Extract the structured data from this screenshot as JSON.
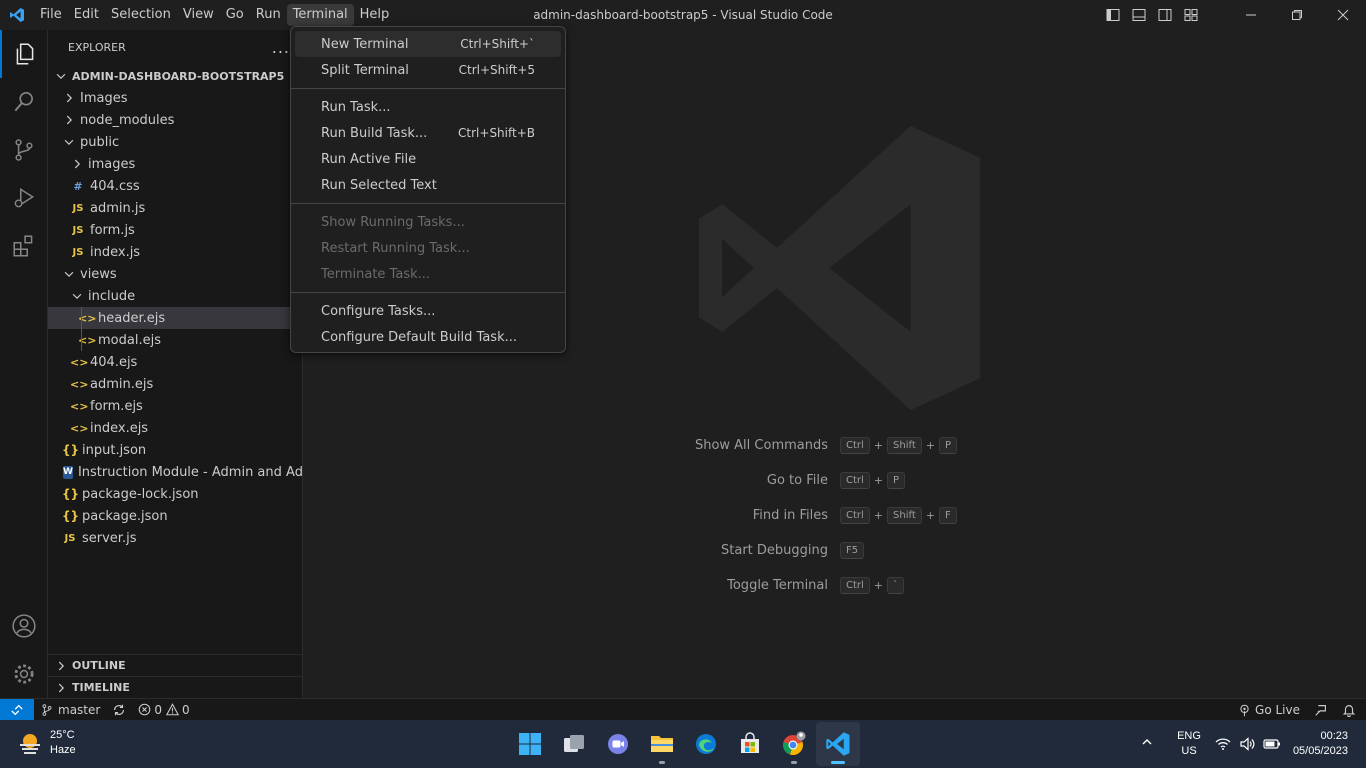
{
  "window": {
    "title": "admin-dashboard-bootstrap5 - Visual Studio Code"
  },
  "menubar": [
    "File",
    "Edit",
    "Selection",
    "View",
    "Go",
    "Run",
    "Terminal",
    "Help"
  ],
  "explorer": {
    "header": "EXPLORER",
    "more": "...",
    "root": "ADMIN-DASHBOARD-BOOTSTRAP5",
    "tree": [
      {
        "label": "Images",
        "type": "folder",
        "depth": 0,
        "open": false
      },
      {
        "label": "node_modules",
        "type": "folder",
        "depth": 0,
        "open": false
      },
      {
        "label": "public",
        "type": "folder",
        "depth": 0,
        "open": true
      },
      {
        "label": "images",
        "type": "folder",
        "depth": 1,
        "open": false
      },
      {
        "label": "404.css",
        "type": "css",
        "depth": 1
      },
      {
        "label": "admin.js",
        "type": "js",
        "depth": 1
      },
      {
        "label": "form.js",
        "type": "js",
        "depth": 1
      },
      {
        "label": "index.js",
        "type": "js",
        "depth": 1
      },
      {
        "label": "views",
        "type": "folder",
        "depth": 0,
        "open": true
      },
      {
        "label": "include",
        "type": "folder",
        "depth": 1,
        "open": true
      },
      {
        "label": "header.ejs",
        "type": "ejs",
        "depth": 2,
        "selected": true
      },
      {
        "label": "modal.ejs",
        "type": "ejs",
        "depth": 2
      },
      {
        "label": "404.ejs",
        "type": "ejs",
        "depth": 1
      },
      {
        "label": "admin.ejs",
        "type": "ejs",
        "depth": 1
      },
      {
        "label": "form.ejs",
        "type": "ejs",
        "depth": 1
      },
      {
        "label": "index.ejs",
        "type": "ejs",
        "depth": 1
      },
      {
        "label": "input.json",
        "type": "json",
        "depth": 0
      },
      {
        "label": "Instruction Module - Admin and Add...",
        "type": "word",
        "depth": 0
      },
      {
        "label": "package-lock.json",
        "type": "json",
        "depth": 0
      },
      {
        "label": "package.json",
        "type": "json",
        "depth": 0
      },
      {
        "label": "server.js",
        "type": "js",
        "depth": 0
      }
    ],
    "outline": "OUTLINE",
    "timeline": "TIMELINE"
  },
  "terminal_menu": {
    "groups": [
      [
        {
          "label": "New Terminal",
          "kb": "Ctrl+Shift+`",
          "highlight": true
        },
        {
          "label": "Split Terminal",
          "kb": "Ctrl+Shift+5"
        }
      ],
      [
        {
          "label": "Run Task...",
          "kb": ""
        },
        {
          "label": "Run Build Task...",
          "kb": "Ctrl+Shift+B"
        },
        {
          "label": "Run Active File",
          "kb": ""
        },
        {
          "label": "Run Selected Text",
          "kb": ""
        }
      ],
      [
        {
          "label": "Show Running Tasks...",
          "kb": "",
          "disabled": true
        },
        {
          "label": "Restart Running Task...",
          "kb": "",
          "disabled": true
        },
        {
          "label": "Terminate Task...",
          "kb": "",
          "disabled": true
        }
      ],
      [
        {
          "label": "Configure Tasks...",
          "kb": ""
        },
        {
          "label": "Configure Default Build Task...",
          "kb": ""
        }
      ]
    ]
  },
  "shortcuts": [
    {
      "label": "Show All Commands",
      "keys": [
        "Ctrl",
        "Shift",
        "P"
      ]
    },
    {
      "label": "Go to File",
      "keys": [
        "Ctrl",
        "P"
      ]
    },
    {
      "label": "Find in Files",
      "keys": [
        "Ctrl",
        "Shift",
        "F"
      ]
    },
    {
      "label": "Start Debugging",
      "keys": [
        "F5"
      ]
    },
    {
      "label": "Toggle Terminal",
      "keys": [
        "Ctrl",
        "`"
      ]
    }
  ],
  "statusbar": {
    "branch": "master",
    "errors": "0",
    "warnings": "0",
    "go_live": "Go Live"
  },
  "taskbar": {
    "temperature": "25°C",
    "condition": "Haze",
    "lang": "ENG",
    "region": "US",
    "time": "00:23",
    "date": "05/05/2023"
  },
  "colors": {
    "accent": "#0078d4",
    "background": "#1f1f1f",
    "sidebar": "#181818"
  }
}
